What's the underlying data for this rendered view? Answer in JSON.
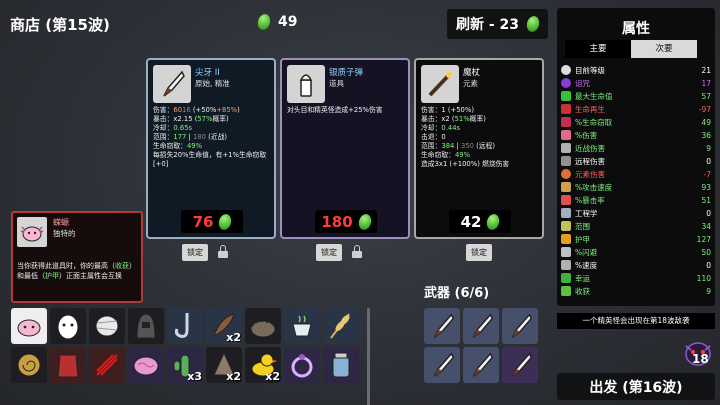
{
  "header": {
    "shop_title": "商店 (第15波)",
    "materials": "49",
    "reroll_label": "刷新 - 23"
  },
  "cards": [
    {
      "name": "尖牙 II",
      "type": "原始, 精准",
      "icon": "fang-icon",
      "stats": [
        {
          "k": "伤害：",
          "v": "60",
          "v2": "16",
          "tail": " (+50%",
          "tail2": "+85%",
          "tail3": ")"
        },
        {
          "k": "暴击：",
          "v": "x2.15",
          "tail": " (",
          "tail2": "57%",
          "tail3": "概率)"
        },
        {
          "k": "冷却：",
          "v": "0.65s"
        },
        {
          "k": "范围：",
          "v": "177",
          "v2": "180",
          "tail": " (近战)"
        },
        {
          "k": "生命窃取：",
          "v": "49%"
        }
      ],
      "extra": "每损失20%生命值，有+1%生命窃取[+0]",
      "price": "76",
      "affordable": false,
      "lock_label": "锁定"
    },
    {
      "name": "银质子弹",
      "type": "道具",
      "icon": "silver-bullet-icon",
      "desc": "对头目和精英怪造成+25%伤害",
      "price": "180",
      "affordable": false,
      "lock_label": "锁定"
    },
    {
      "name": "魔杖",
      "type": "元素",
      "icon": "wand-icon",
      "stats": [
        {
          "k": "伤害：",
          "v": "1",
          "tail": " (+50%",
          "tail3": ")"
        },
        {
          "k": "暴击：",
          "v": "x2",
          "tail": " (",
          "tail2": "51%",
          "tail3": "概率)"
        },
        {
          "k": "冷却：",
          "v": "0.44s"
        },
        {
          "k": "击退：",
          "v": "0"
        },
        {
          "k": "范围：",
          "v": "384",
          "v2": "350",
          "tail": " (远程)"
        },
        {
          "k": "生命窃取：",
          "v": "49%"
        }
      ],
      "extra": "造成3x1 (+100%) 燃烧伤害",
      "price": "42",
      "affordable": true,
      "lock_label": "锁定"
    }
  ],
  "tooltip": {
    "name": "蝾螈",
    "type": "独特的",
    "desc_parts": [
      "当你获得此道具时，你的最高（",
      "收获",
      "）和最低（",
      "护甲",
      "）正面主属性会互换"
    ]
  },
  "items": [
    {
      "icon": "axolotl-icon",
      "qty": ""
    },
    {
      "icon": "egg-icon",
      "qty": ""
    },
    {
      "icon": "mummy-icon",
      "qty": ""
    },
    {
      "icon": "hood-icon",
      "qty": ""
    },
    {
      "icon": "hook-icon",
      "qty": ""
    },
    {
      "icon": "feather-icon",
      "qty": "x2"
    },
    {
      "icon": "hedgehog-icon",
      "qty": ""
    },
    {
      "icon": "tea-icon",
      "qty": ""
    },
    {
      "icon": "wheat-icon",
      "qty": ""
    },
    {
      "icon": "snail-icon",
      "qty": ""
    },
    {
      "icon": "robe-icon",
      "qty": ""
    },
    {
      "icon": "claw-icon",
      "qty": ""
    },
    {
      "icon": "brain-icon",
      "qty": ""
    },
    {
      "icon": "cactus-icon",
      "qty": "x3"
    },
    {
      "icon": "fang-bag-icon",
      "qty": "x2"
    },
    {
      "icon": "duck-icon",
      "qty": "x2"
    },
    {
      "icon": "ring-icon",
      "qty": ""
    },
    {
      "icon": "jar-icon",
      "qty": ""
    }
  ],
  "weapons": {
    "title": "武器 (6/6)"
  },
  "stats_panel": {
    "title": "属性",
    "tab_primary": "主要",
    "tab_secondary": "次要",
    "rows": [
      {
        "label": "目前等级",
        "value": "21",
        "color": "#ffffff"
      },
      {
        "label": "诅咒",
        "value": "17",
        "color": "#c86df5"
      },
      {
        "label": "最大生命值",
        "value": "57",
        "color": "#7ef07e"
      },
      {
        "label": "生命再生",
        "value": "-97",
        "color": "#ff6060"
      },
      {
        "label": "%生命窃取",
        "value": "49",
        "color": "#7ef07e"
      },
      {
        "label": "%伤害",
        "value": "36",
        "color": "#7ef07e"
      },
      {
        "label": "近战伤害",
        "value": "9",
        "color": "#7ef07e"
      },
      {
        "label": "远程伤害",
        "value": "0",
        "color": "#ffffff"
      },
      {
        "label": "元素伤害",
        "value": "-7",
        "color": "#ff6060"
      },
      {
        "label": "%攻击速度",
        "value": "93",
        "color": "#7ef07e"
      },
      {
        "label": "%暴击率",
        "value": "51",
        "color": "#7ef07e"
      },
      {
        "label": "工程学",
        "value": "0",
        "color": "#ffffff"
      },
      {
        "label": "范围",
        "value": "34",
        "color": "#7ef07e"
      },
      {
        "label": "护甲",
        "value": "127",
        "color": "#7ef07e"
      },
      {
        "label": "%闪避",
        "value": "50",
        "color": "#7ef07e"
      },
      {
        "label": "%速度",
        "value": "0",
        "color": "#ffffff"
      },
      {
        "label": "幸运",
        "value": "110",
        "color": "#7ef07e"
      },
      {
        "label": "收获",
        "value": "9",
        "color": "#7ef07e"
      }
    ]
  },
  "elite_banner": "一个精英怪会出现在第18波敌袭",
  "danger_level": "18",
  "go_button": "出发 (第16波)"
}
